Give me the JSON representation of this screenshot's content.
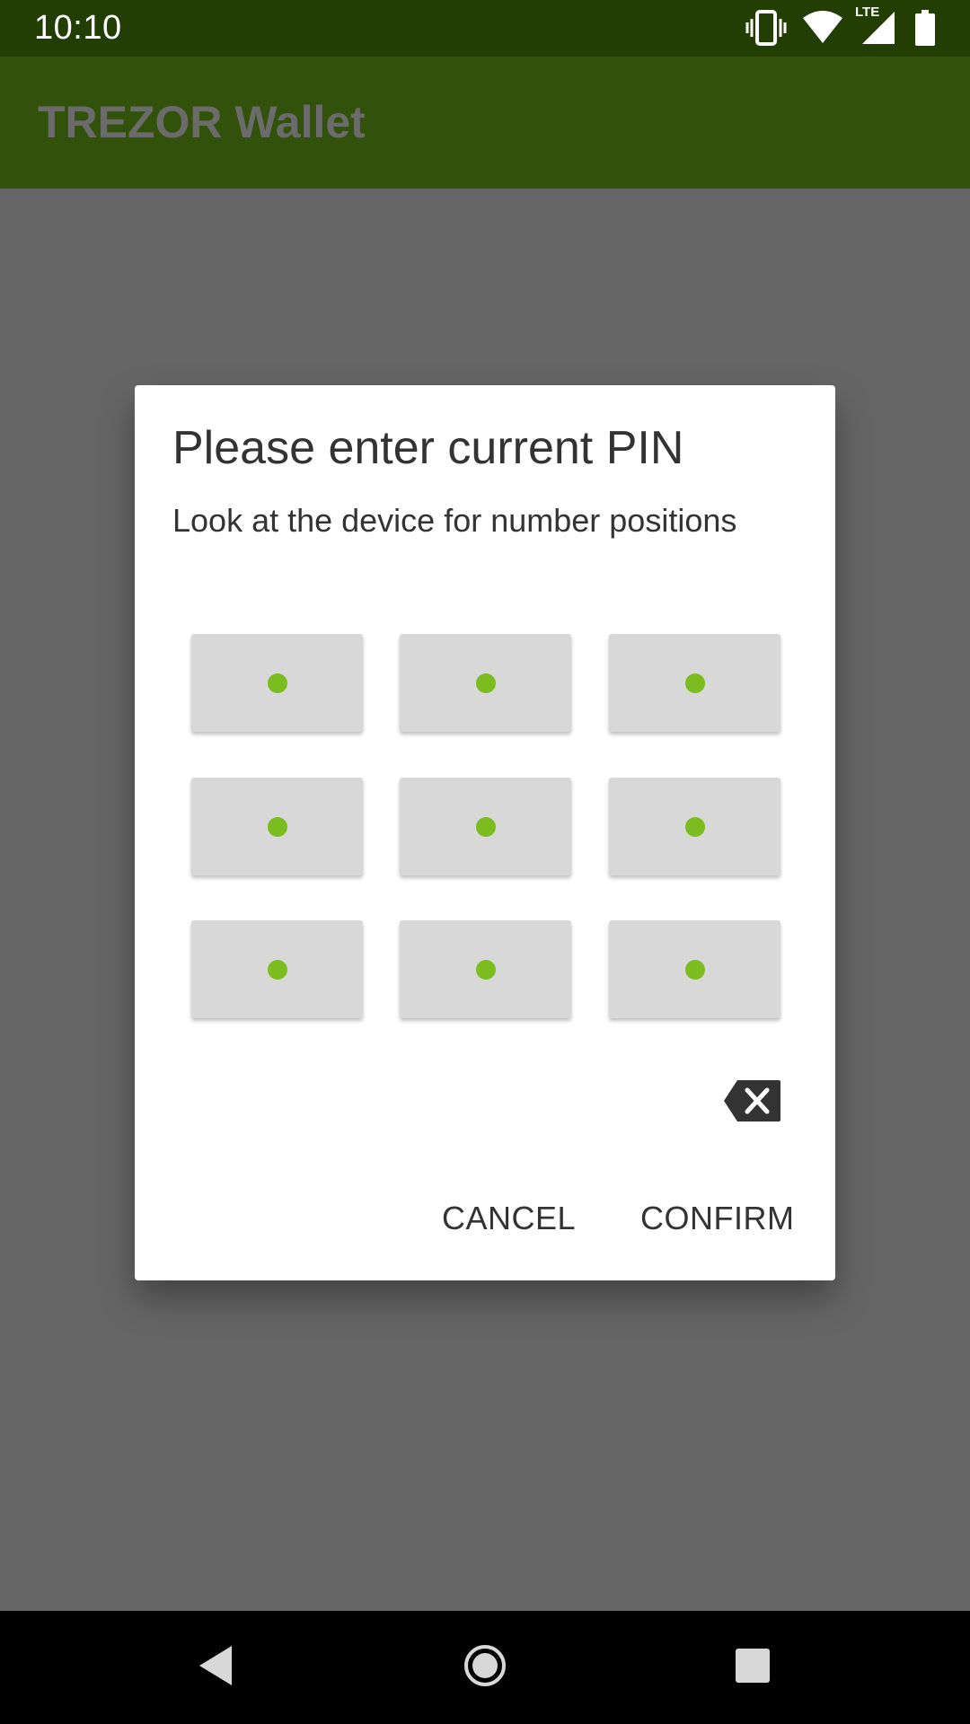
{
  "status_bar": {
    "time": "10:10",
    "network_label": "LTE",
    "icons": [
      "vibrate-icon",
      "wifi-icon",
      "signal-icon",
      "battery-icon"
    ]
  },
  "app_bar": {
    "title": "TREZOR Wallet"
  },
  "dialog": {
    "title": "Please enter current PIN",
    "subtitle": "Look at the device for number positions",
    "pin_keys": [
      "",
      "",
      "",
      "",
      "",
      "",
      "",
      "",
      ""
    ],
    "backspace_icon": "backspace-icon",
    "cancel_label": "CANCEL",
    "confirm_label": "CONFIRM"
  },
  "navigation": {
    "back_icon": "back-icon",
    "home_icon": "home-icon",
    "recents_icon": "recents-icon"
  },
  "colors": {
    "status_bar": "#223e03",
    "app_bar": "#32510b",
    "scrim": "#666666",
    "pin_dot": "#7bbd1f",
    "pin_key": "#d8d8d8"
  }
}
